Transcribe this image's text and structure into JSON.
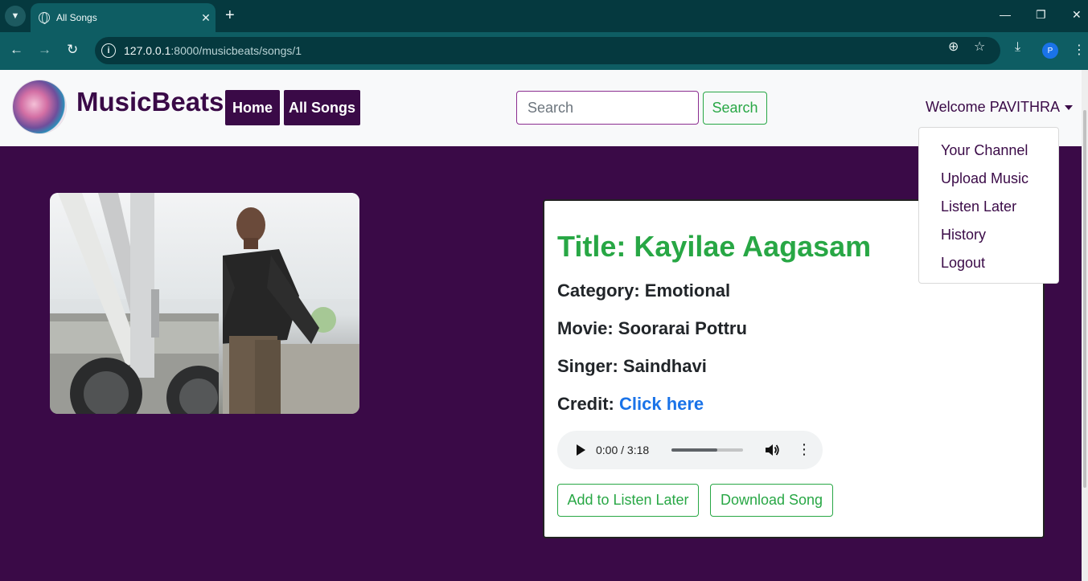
{
  "browser": {
    "tab_title": "All Songs",
    "tab_close": "✕",
    "new_tab": "+",
    "url_host": "127.0.0.1",
    "url_path": ":8000/musicbeats/songs/1",
    "profile_initial": "P",
    "window_controls": [
      "—",
      "❐",
      "✕"
    ]
  },
  "navbar": {
    "brand": "MusicBeats",
    "links": [
      "Home",
      "All Songs"
    ],
    "search_placeholder": "Search",
    "search_button": "Search",
    "welcome": "Welcome PAVITHRA"
  },
  "dropdown": {
    "items": [
      "Your Channel",
      "Upload Music",
      "Listen Later",
      "History",
      "Logout"
    ]
  },
  "song": {
    "title": "Title: Kayilae Aagasam",
    "category": "Category: Emotional",
    "movie": "Movie: Soorarai Pottru",
    "singer": "Singer: Saindhavi",
    "credit_label": "Credit: ",
    "credit_link": "Click here",
    "audio_time": "0:00 / 3:18",
    "audio_buffered_fraction": 0.64,
    "add_listen_later": "Add to Listen Later",
    "download": "Download Song"
  },
  "colors": {
    "brand_purple": "#3a0a47",
    "success_green": "#28a745",
    "link_blue": "#1a73e8"
  }
}
